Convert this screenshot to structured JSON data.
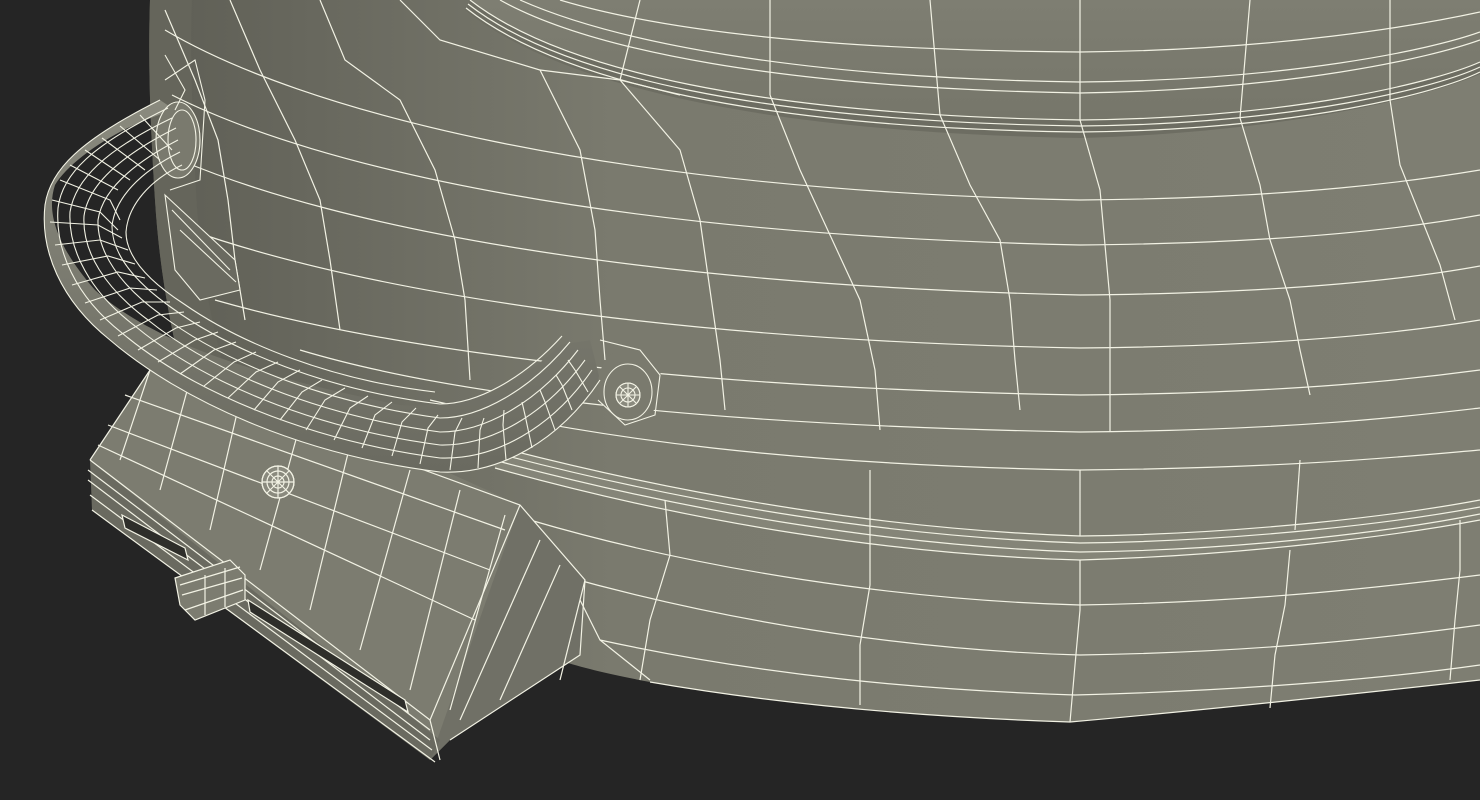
{
  "scene": {
    "subject": "wireframe-3d-render",
    "colors": {
      "background": "#252525",
      "surface": "#7c7c70",
      "surface_dark": "#5e5e55",
      "surface_light": "#8a8a7e",
      "wire": "#f2f2e4"
    }
  }
}
